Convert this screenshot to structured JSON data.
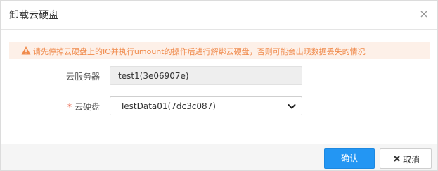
{
  "dialog": {
    "title": "卸载云硬盘",
    "close_icon": "close-icon"
  },
  "warning": {
    "icon": "warning-icon",
    "text": "请先停掉云硬盘上的IO并执行umount的操作后进行解绑云硬盘，否则可能会出现数据丢失的情况",
    "color": "#f08a4b",
    "background": "#fdf0e8"
  },
  "form": {
    "server_label": "云服务器",
    "server_value": "test1(3e06907e)",
    "disk_required_mark": "*",
    "disk_label": "云硬盘",
    "disk_selected": "TestData01(7dc3c087)"
  },
  "footer": {
    "confirm_label": "确认",
    "cancel_label": "取消",
    "confirm_color": "#2396f3"
  }
}
